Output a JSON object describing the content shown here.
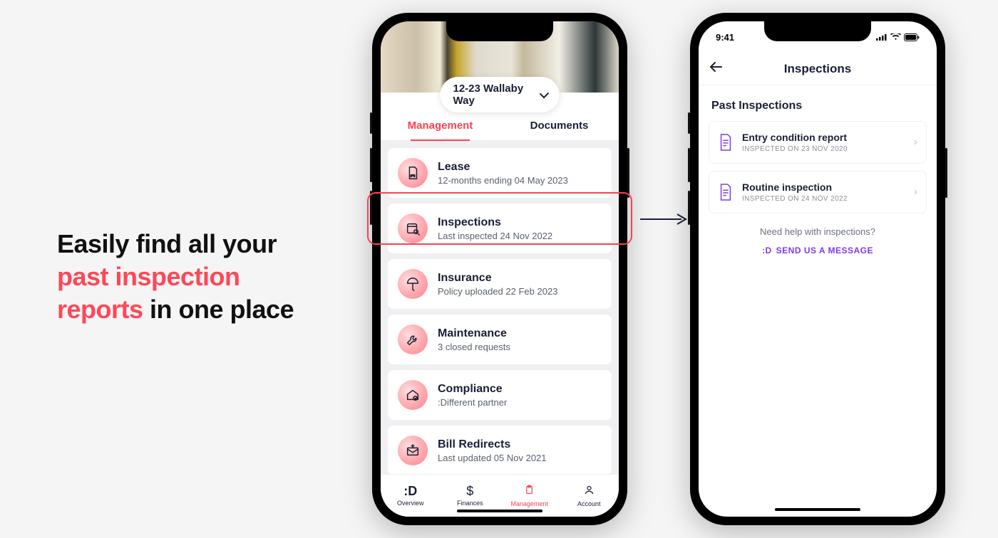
{
  "headline": {
    "line1": "Easily find all your",
    "line2_accent": "past inspection",
    "line3_accent": "reports",
    "line3_rest": " in one place"
  },
  "colors": {
    "accent": "#ff4757",
    "brand_purple": "#7c3aed"
  },
  "phone1": {
    "property_name": "12-23 Wallaby Way",
    "tabs": {
      "management": "Management",
      "documents": "Documents"
    },
    "cards": [
      {
        "title": "Lease",
        "subtitle": "12-months ending 04 May 2023"
      },
      {
        "title": "Inspections",
        "subtitle": "Last inspected 24 Nov 2022"
      },
      {
        "title": "Insurance",
        "subtitle": "Policy uploaded 22 Feb 2023"
      },
      {
        "title": "Maintenance",
        "subtitle": "3 closed requests"
      },
      {
        "title": "Compliance",
        "subtitle": ":Different partner"
      },
      {
        "title": "Bill Redirects",
        "subtitle": "Last updated 05 Nov 2021"
      }
    ],
    "nav": {
      "overview": "Overview",
      "finances": "Finances",
      "management": "Management",
      "account": "Account"
    }
  },
  "phone2": {
    "status_time": "9:41",
    "header_title": "Inspections",
    "section_title": "Past Inspections",
    "items": [
      {
        "title": "Entry condition report",
        "subtitle": "INSPECTED ON 23 NOV 2020"
      },
      {
        "title": "Routine inspection",
        "subtitle": "INSPECTED ON 24 NOV 2022"
      }
    ],
    "help_question": "Need help with inspections?",
    "help_cta_logo": ":D",
    "help_cta": "SEND US A MESSAGE"
  }
}
